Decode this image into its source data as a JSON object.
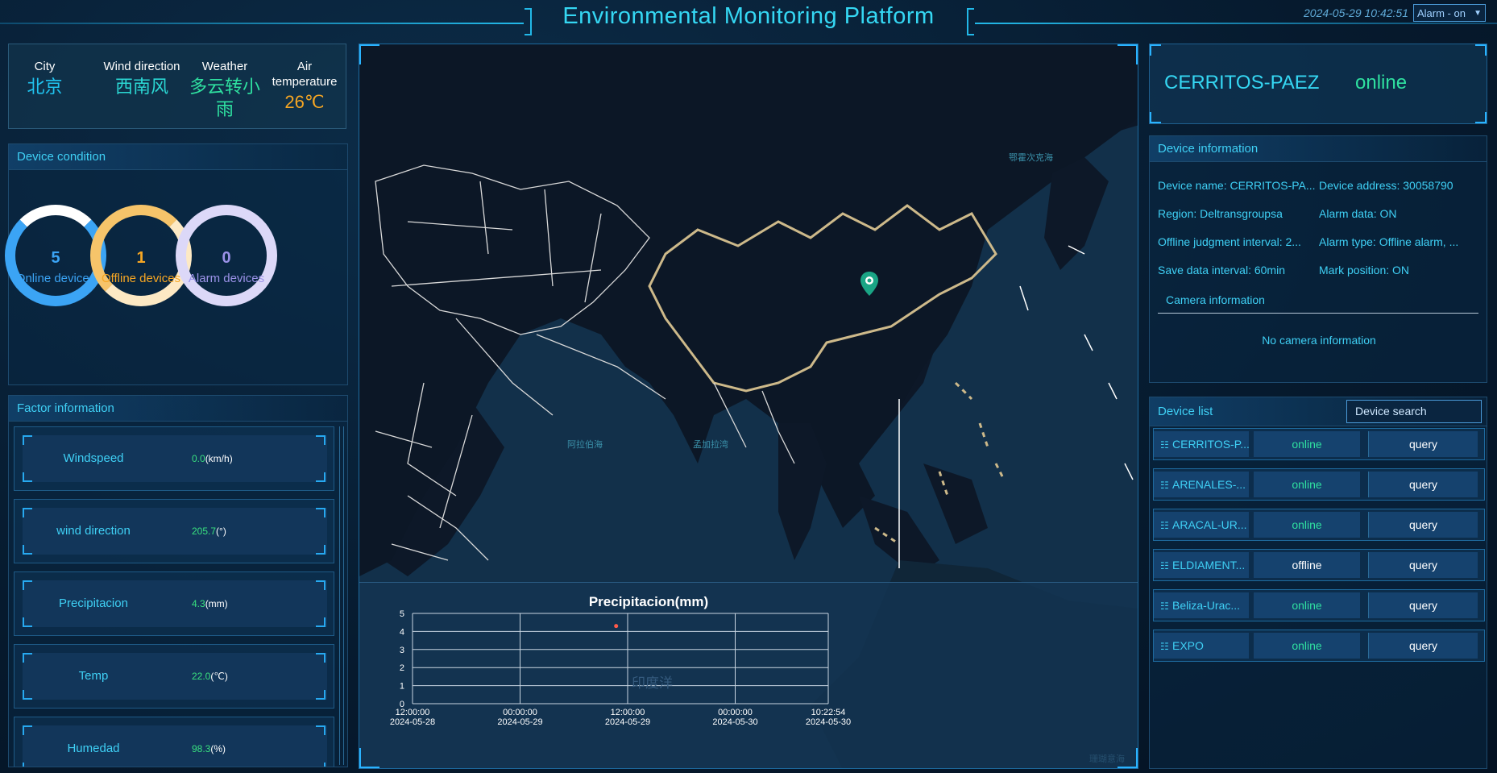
{
  "header": {
    "title": "Environmental Monitoring Platform",
    "datetime": "2024-05-29 10:42:51",
    "alarm_select": "Alarm - on"
  },
  "weather": {
    "city_label": "City",
    "city_value": "北京",
    "wind_label": "Wind direction",
    "wind_value": "西南风",
    "weather_label": "Weather",
    "weather_value_line1": "多云转小",
    "weather_value_line2": "雨",
    "temp_label_line1": "Air",
    "temp_label_line2": "temperature",
    "temp_value": "26℃"
  },
  "device_condition": {
    "title": "Device condition",
    "online": {
      "count": "5",
      "label": "Online devices",
      "color": "#3ba4f5"
    },
    "offline": {
      "count": "1",
      "label": "Offline devices",
      "color": "#f6c46a"
    },
    "alarm": {
      "count": "0",
      "label": "Alarm devices",
      "color": "#d7d3f5"
    }
  },
  "factor": {
    "title": "Factor information",
    "items": [
      {
        "name": "Windspeed",
        "value": "0.0",
        "unit": "(km/h)"
      },
      {
        "name": "wind direction",
        "value": "205.7",
        "unit": "(°)"
      },
      {
        "name": "Precipitacion",
        "value": "4.3",
        "unit": "(mm)"
      },
      {
        "name": "Temp",
        "value": "22.0",
        "unit": "(℃)"
      },
      {
        "name": "Humedad",
        "value": "98.3",
        "unit": "(%)"
      }
    ]
  },
  "map": {
    "labels": {
      "okhotsk": "鄂霍次克海",
      "arabian": "阿拉伯海",
      "bengal": "孟加拉湾",
      "indian": "印度洋",
      "corner": "珊瑚意海"
    }
  },
  "chart_data": {
    "type": "scatter",
    "title": "Precipitacion(mm)",
    "x_ticks": [
      {
        "time": "12:00:00",
        "date": "2024-05-28"
      },
      {
        "time": "00:00:00",
        "date": "2024-05-29"
      },
      {
        "time": "12:00:00",
        "date": "2024-05-29"
      },
      {
        "time": "00:00:00",
        "date": "2024-05-30"
      },
      {
        "time": "10:22:54",
        "date": "2024-05-30"
      }
    ],
    "y_ticks": [
      0,
      1,
      2,
      3,
      4,
      5
    ],
    "ylim": [
      0,
      5
    ],
    "points": [
      {
        "x": "2024-05-29 10:42:51",
        "y": 4.3
      }
    ],
    "point_color": "#ff5a4a",
    "grid": true
  },
  "device_header": {
    "name": "CERRITOS-PAEZ",
    "status": "online"
  },
  "device_info": {
    "title": "Device information",
    "name": "Device name: CERRITOS-PA...",
    "address": "Device address: 30058790",
    "region": "Region: Deltransgroupsa",
    "alarm_data": "Alarm data: ON",
    "offline_interval": "Offline judgment interval: 2...",
    "alarm_type": "Alarm type: Offline alarm, ...",
    "save_interval": "Save data interval: 60min",
    "mark_position": "Mark position: ON",
    "camera_title": "Camera information",
    "camera_none": "No camera information"
  },
  "device_list": {
    "title": "Device list",
    "search_placeholder": "Device search",
    "query_label": "query",
    "rows": [
      {
        "name": "CERRITOS-P...",
        "status": "online"
      },
      {
        "name": "ARENALES-...",
        "status": "online"
      },
      {
        "name": "ARACAL-UR...",
        "status": "online"
      },
      {
        "name": "ELDIAMENT...",
        "status": "offline"
      },
      {
        "name": "Beliza-Urac...",
        "status": "online"
      },
      {
        "name": "EXPO",
        "status": "online"
      }
    ]
  }
}
